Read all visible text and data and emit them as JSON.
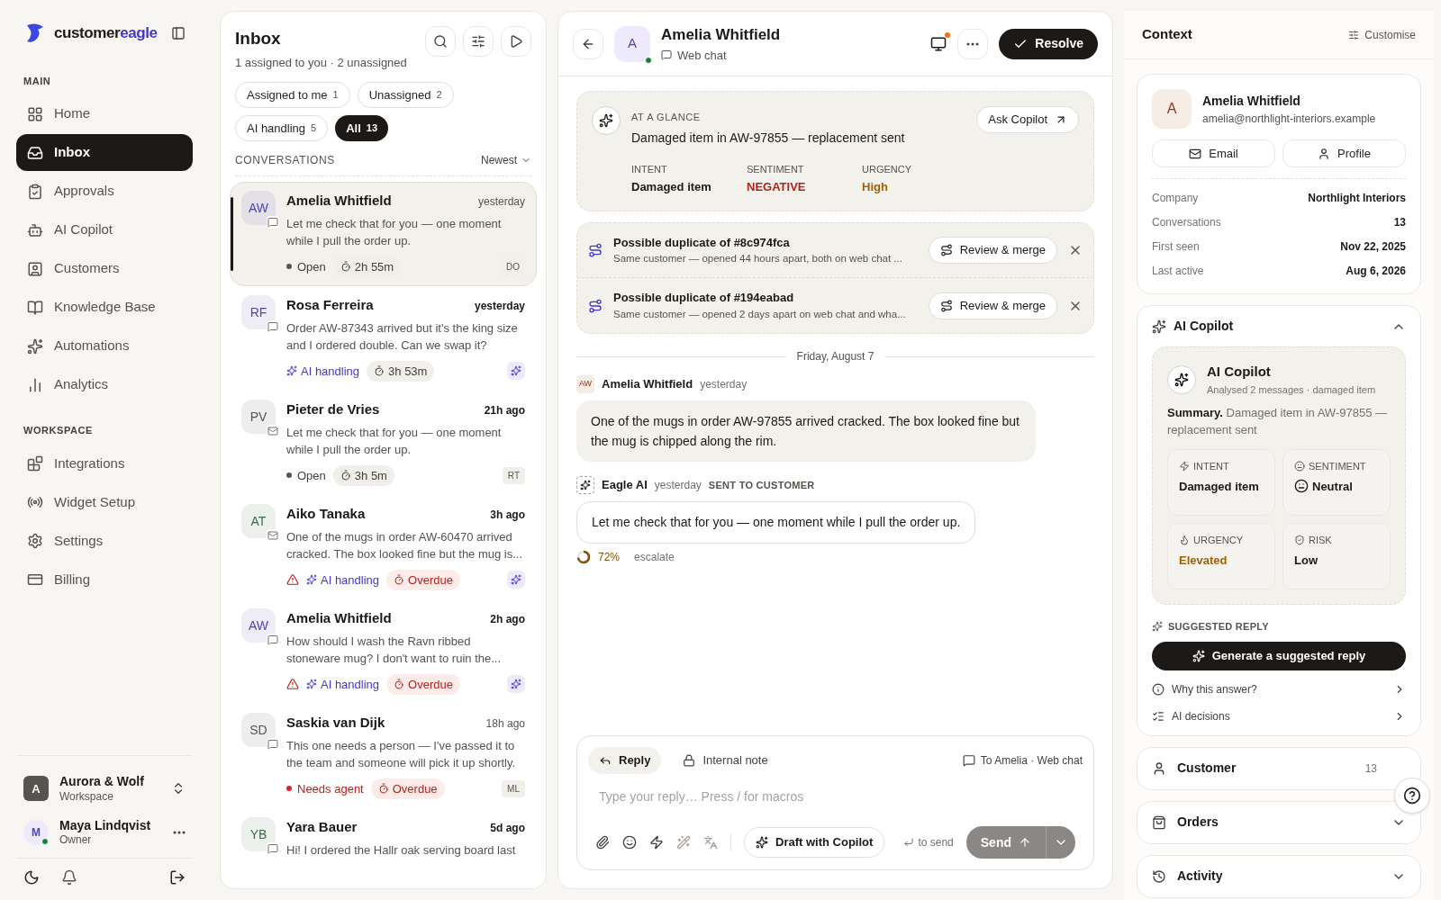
{
  "sidebar": {
    "brand": {
      "prefix": "customer",
      "suffix": "eagle"
    },
    "sections": [
      {
        "heading": "MAIN",
        "items": [
          {
            "label": "Home",
            "selected": false
          },
          {
            "label": "Inbox",
            "selected": true
          },
          {
            "label": "Approvals",
            "selected": false
          },
          {
            "label": "AI Copilot",
            "selected": false
          },
          {
            "label": "Customers",
            "selected": false
          },
          {
            "label": "Knowledge Base",
            "selected": false
          },
          {
            "label": "Automations",
            "selected": false
          },
          {
            "label": "Analytics",
            "selected": false
          }
        ]
      },
      {
        "heading": "WORKSPACE",
        "items": [
          {
            "label": "Integrations",
            "selected": false
          },
          {
            "label": "Widget Setup",
            "selected": false
          },
          {
            "label": "Settings",
            "selected": false
          },
          {
            "label": "Billing",
            "selected": false
          }
        ]
      }
    ],
    "workspace": {
      "initial": "A",
      "name": "Aurora & Wolf",
      "sub": "Workspace"
    },
    "user": {
      "initial": "M",
      "name": "Maya Lindqvist",
      "role": "Owner",
      "online": true
    }
  },
  "inbox": {
    "title": "Inbox",
    "subtitle": "1 assigned to you · 2 unassigned",
    "filters": [
      {
        "label": "Assigned to me",
        "count": "1",
        "selected": false
      },
      {
        "label": "Unassigned",
        "count": "2",
        "selected": false
      },
      {
        "label": "AI handling",
        "count": "5",
        "selected": false
      },
      {
        "label": "All",
        "count": "13",
        "selected": true
      }
    ],
    "section_label": "CONVERSATIONS",
    "sort": "Newest",
    "conversations": [
      {
        "initials": "AW",
        "color": "#4f46b5",
        "kind": "chat",
        "name": "Amelia Whitfield",
        "time": "yesterday",
        "unread": false,
        "selected": true,
        "preview": "Let me check that for you — one moment while I pull the order up.",
        "tags": [
          {
            "kind": "status",
            "text": "Open"
          },
          {
            "kind": "timer",
            "text": "2h 55m"
          }
        ],
        "badge": {
          "kind": "initials",
          "text": "DO"
        }
      },
      {
        "initials": "RF",
        "color": "#4f46b5",
        "kind": "chat",
        "name": "Rosa Ferreira",
        "time": "yesterday",
        "unread": true,
        "selected": false,
        "preview": "Order AW-87343 arrived but it's the king size and I ordered double. Can we swap it?",
        "tags": [
          {
            "kind": "ai",
            "text": "AI handling"
          },
          {
            "kind": "timer",
            "text": "3h 53m"
          }
        ],
        "badge": {
          "kind": "ai"
        }
      },
      {
        "initials": "PV",
        "color": "#57534e",
        "kind": "email",
        "name": "Pieter de Vries",
        "time": "21h ago",
        "unread": true,
        "selected": false,
        "preview": "Let me check that for you — one moment while I pull the order up.",
        "tags": [
          {
            "kind": "status",
            "text": "Open"
          },
          {
            "kind": "timer",
            "text": "3h 5m"
          }
        ],
        "badge": {
          "kind": "initials",
          "text": "RT"
        }
      },
      {
        "initials": "AT",
        "color": "#3f6b4a",
        "kind": "email",
        "name": "Aiko Tanaka",
        "time": "3h ago",
        "unread": true,
        "selected": false,
        "preview": "One of the mugs in order AW-60470 arrived cracked. The box looked fine but the mug is...",
        "tags": [
          {
            "kind": "warning"
          },
          {
            "kind": "ai",
            "text": "AI handling"
          },
          {
            "kind": "overdue",
            "text": "Overdue"
          }
        ],
        "badge": {
          "kind": "ai"
        }
      },
      {
        "initials": "AW",
        "color": "#4f46b5",
        "kind": "chat",
        "name": "Amelia Whitfield",
        "time": "2h ago",
        "unread": true,
        "selected": false,
        "preview": "How should I wash the Ravn ribbed stoneware mug? I don't want to ruin the...",
        "tags": [
          {
            "kind": "warning"
          },
          {
            "kind": "ai",
            "text": "AI handling"
          },
          {
            "kind": "overdue",
            "text": "Overdue"
          }
        ],
        "badge": {
          "kind": "ai"
        }
      },
      {
        "initials": "SD",
        "color": "#57534e",
        "kind": "chat",
        "name": "Saskia van Dijk",
        "time": "18h ago",
        "unread": false,
        "selected": false,
        "preview": "This one needs a person — I've passed it to the team and someone will pick it up shortly.",
        "tags": [
          {
            "kind": "needs",
            "text": "Needs agent"
          },
          {
            "kind": "overdue",
            "text": "Overdue"
          }
        ],
        "badge": {
          "kind": "initials",
          "text": "ML"
        }
      },
      {
        "initials": "YB",
        "color": "#3f6b4a",
        "kind": "chat",
        "name": "Yara Bauer",
        "time": "5d ago",
        "unread": true,
        "selected": false,
        "preview": "Hi! I ordered the Hallr oak serving board last"
      }
    ]
  },
  "conversation": {
    "avatar": "A",
    "online": true,
    "name": "Amelia Whitfield",
    "channel": "Web chat",
    "notification": true,
    "resolve": "Resolve",
    "glance": {
      "label": "AT A GLANCE",
      "summary": "Damaged item in AW-97855 — replacement sent",
      "ask": "Ask Copilot",
      "fields": [
        {
          "label": "INTENT",
          "value": "Damaged item",
          "color": "#1c1917"
        },
        {
          "label": "SENTIMENT",
          "value": "NEGATIVE",
          "color": "#b42318"
        },
        {
          "label": "URGENCY",
          "value": "High",
          "color": "#a16207"
        }
      ]
    },
    "duplicates": [
      {
        "title": "Possible duplicate of #8c974fca",
        "detail": "Same customer — opened 44 hours apart, both on web chat ...",
        "action": "Review & merge"
      },
      {
        "title": "Possible duplicate of #194eabad",
        "detail": "Same customer — opened 2 days apart on web chat and wha...",
        "action": "Review & merge"
      }
    ],
    "date": "Friday, August 7",
    "messages": [
      {
        "kind": "customer",
        "initials": "AW",
        "author": "Amelia Whitfield",
        "time": "yesterday",
        "text": "One of the mugs in order AW-97855 arrived cracked. The box looked fine but the mug is chipped along the rim."
      },
      {
        "kind": "ai",
        "author": "Eagle AI",
        "time": "yesterday",
        "tag": "SENT TO CUSTOMER",
        "text": "Let me check that for you — one moment while I pull the order up.",
        "confidence": "72%",
        "action": "escalate"
      }
    ],
    "composer": {
      "tabs": [
        {
          "label": "Reply",
          "selected": true
        },
        {
          "label": "Internal note",
          "selected": false
        }
      ],
      "recipient": "To Amelia · Web chat",
      "placeholder": "Type your reply… Press / for macros",
      "draft": "Draft with Copilot",
      "hint": "to send",
      "send": "Send",
      "send_disabled": true
    }
  },
  "context": {
    "title": "Context",
    "customise": "Customise",
    "customer": {
      "initial": "A",
      "name": "Amelia Whitfield",
      "email": "amelia@northlight-interiors.example",
      "buttons": [
        "Email",
        "Profile"
      ],
      "facts": [
        {
          "label": "Company",
          "value": "Northlight Interiors"
        },
        {
          "label": "Conversations",
          "value": "13"
        },
        {
          "label": "First seen",
          "value": "Nov 22, 2025"
        },
        {
          "label": "Last active",
          "value": "Aug 6, 2026"
        }
      ]
    },
    "copilot": {
      "title": "AI Copilot",
      "expanded": true,
      "card_title": "AI Copilot",
      "card_sub": "Analysed 2 messages · damaged item",
      "summary": "**Summary.** Damaged item in AW-97855 — replacement sent",
      "metrics": [
        {
          "label": "INTENT",
          "value": "Damaged item",
          "color": "#1c1917"
        },
        {
          "label": "SENTIMENT",
          "value": "Neutral",
          "color": "#1c1917"
        },
        {
          "label": "URGENCY",
          "value": "Elevated",
          "color": "#a16207"
        },
        {
          "label": "RISK",
          "value": "Low",
          "color": "#1c1917"
        }
      ],
      "suggested_label": "SUGGESTED REPLY",
      "generate": "Generate a suggested reply",
      "links": [
        "Why this answer?",
        "AI decisions"
      ]
    },
    "sections": [
      {
        "title": "Customer",
        "count": "13"
      },
      {
        "title": "Orders",
        "expanded": false
      },
      {
        "title": "Activity",
        "expanded": false
      }
    ]
  }
}
